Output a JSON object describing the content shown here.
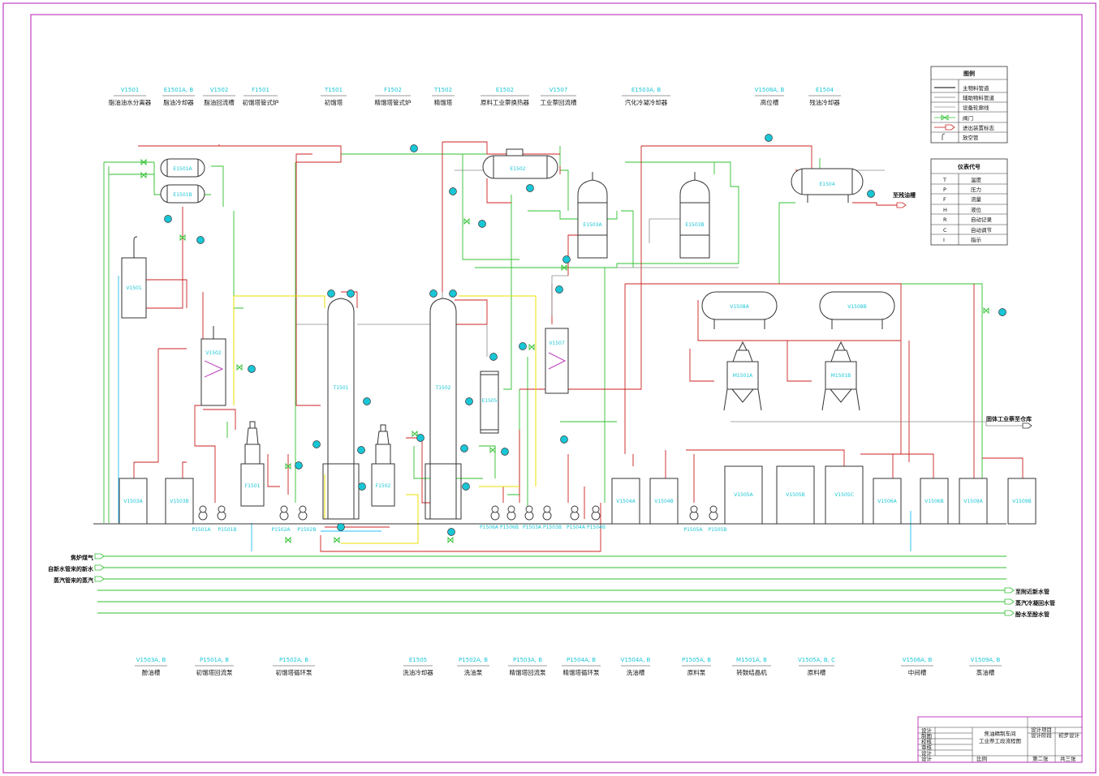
{
  "top_labels": [
    {
      "code": "V1501",
      "name": "脂油油水分离器"
    },
    {
      "code": "E1501A, B",
      "name": "脂油冷却器"
    },
    {
      "code": "V1502",
      "name": "脂油回流槽"
    },
    {
      "code": "F1501",
      "name": "初馏塔管式炉"
    },
    {
      "code": "T1501",
      "name": "初馏塔"
    },
    {
      "code": "F1502",
      "name": "精馏塔管式炉"
    },
    {
      "code": "T1502",
      "name": "精馏塔"
    },
    {
      "code": "E1502",
      "name": "原料工业萘换热器"
    },
    {
      "code": "V1507",
      "name": "工业萘回流槽"
    },
    {
      "code": "E1503A, B",
      "name": "汽化冷凝冷却器"
    },
    {
      "code": "V1508A, B",
      "name": "高位槽"
    },
    {
      "code": "E1504",
      "name": "残油冷却器"
    }
  ],
  "bottom_labels": [
    {
      "code": "V1503A, B",
      "name": "酚油槽"
    },
    {
      "code": "P1501A, B",
      "name": "初馏塔回流泵"
    },
    {
      "code": "P1502A, B",
      "name": "初馏塔循环泵"
    },
    {
      "code": "E1505",
      "name": "洗油冷却器"
    },
    {
      "code": "P1502A, B",
      "name": "洗油泵"
    },
    {
      "code": "P1503A, B",
      "name": "精馏塔回流泵"
    },
    {
      "code": "P1504A, B",
      "name": "精馏塔循环泵"
    },
    {
      "code": "V1504A, B",
      "name": "洗油槽"
    },
    {
      "code": "P1505A, B",
      "name": "原料泵"
    },
    {
      "code": "M1501A, B",
      "name": "转鼓结晶机"
    },
    {
      "code": "V1505A, B, C",
      "name": "原料槽"
    },
    {
      "code": "V1506A, B",
      "name": "中间槽"
    },
    {
      "code": "V1509A, B",
      "name": "蒸油槽"
    }
  ],
  "legend": {
    "title": "图例",
    "items": [
      "主物料管道",
      "辅助物料管道",
      "设备轮廓线",
      "阀门",
      "进出装置标志",
      "放空管"
    ]
  },
  "instrument": {
    "title": "仪表代号",
    "items": [
      [
        "T",
        "温度"
      ],
      [
        "P",
        "压力"
      ],
      [
        "F",
        "流量"
      ],
      [
        "H",
        "液位"
      ],
      [
        "R",
        "自动记录"
      ],
      [
        "C",
        "自动调节"
      ],
      [
        "I",
        "指示"
      ]
    ]
  },
  "equipment_tags": {
    "e1501a": "E1501A",
    "e1501b": "E1501B",
    "v1501": "V1501",
    "v1502": "V1502",
    "t1501": "T1501",
    "t1502": "T1502",
    "e1502": "E1502",
    "e1503a": "E1503A",
    "e1503b": "E1503B",
    "e1504": "E1504",
    "v1508a": "V1508A",
    "v1508b": "V1508B",
    "v1507": "V1507",
    "m1501a": "M1501A",
    "m1501b": "M1501B",
    "e1505": "E1505",
    "f1501": "F1501",
    "f1502": "F1502",
    "v1503a": "V1503A",
    "v1503b": "V1503B",
    "v1504a": "V1504A",
    "v1504b": "V1504B",
    "v1505a": "V1505A",
    "v1505b": "V1505B",
    "v1505c": "V1505C",
    "v1506a": "V1506A",
    "v1506b": "V1506B",
    "v1509a": "V1509A",
    "v1509b": "V1509B"
  },
  "pump_tags": {
    "p1501a": "P1501A",
    "p1501b": "P1501B",
    "p1502a": "P1502A",
    "p1502b": "P1502B",
    "p1503": "P1503A P1503B",
    "p1504": "P1504A P1504B",
    "p1505a": "P1505A",
    "p1505b": "P1505B",
    "p1506": "P1506A P1506B"
  },
  "streams_in": [
    "焦炉煤气",
    "自新水管来的新水",
    "蒸汽管来的蒸汽"
  ],
  "streams_out": [
    "至附近新水管",
    "蒸汽冷凝回水管",
    "酚水至酚水管"
  ],
  "stream_residue": "至残油槽",
  "stream_solid": "固体工业萘至仓库",
  "title_block": {
    "roles": [
      "设计",
      "制图",
      "校核",
      "审核",
      "设计",
      "设计"
    ],
    "title1": "焦油精制车间",
    "title2": "工业萘工段流程图",
    "stage_label": "设计项目",
    "stage_value": "",
    "phase_label": "设计阶段",
    "phase_value": "初步设计",
    "scale": "比例",
    "sheet": "第二张",
    "total": "共三张"
  },
  "colors": {
    "main": "#cc2020",
    "aux": "#30c030",
    "equip": "#333333",
    "yellow": "#e8e000",
    "blue": "#20c0f0",
    "gray": "#8a8a8a",
    "cyan": "#19c6d6",
    "frame": "#c040c0"
  }
}
